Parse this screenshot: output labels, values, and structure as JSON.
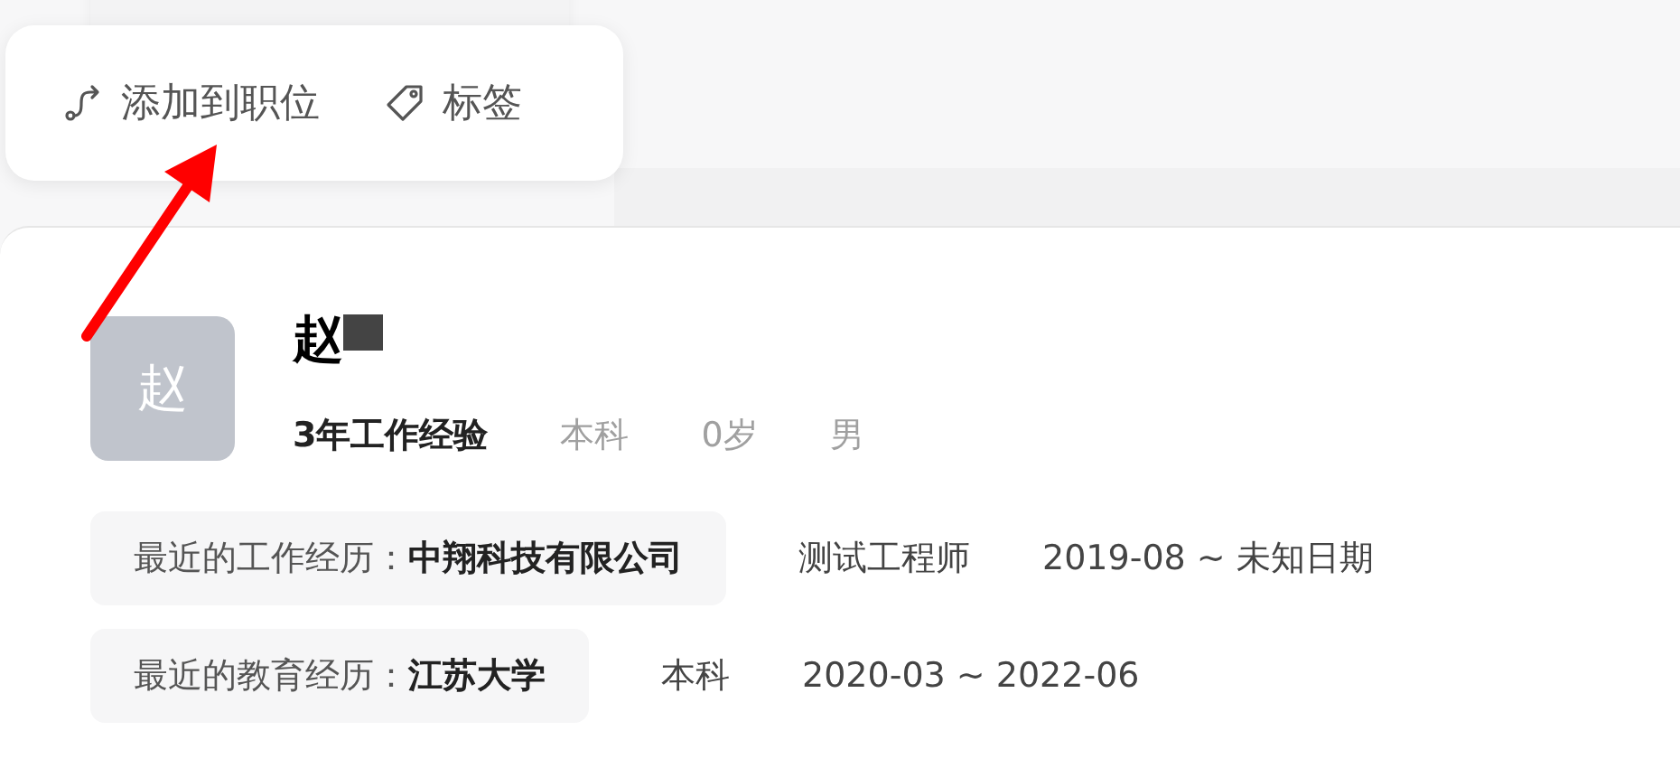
{
  "popover": {
    "actions": [
      {
        "kind": "route",
        "label": "添加到职位"
      },
      {
        "kind": "tag",
        "label": "标签"
      }
    ]
  },
  "candidate": {
    "avatar": "赵",
    "name": "赵",
    "name_redacted": true,
    "experience": "3年工作经验",
    "meta": [
      "本科",
      "0岁",
      "男"
    ],
    "history": [
      {
        "label": "最近的工作经历：",
        "value": "中翔科技有限公司",
        "details": [
          "测试工程师",
          "2019-08 ~ 未知日期"
        ]
      },
      {
        "label": "最近的教育经历：",
        "value": "江苏大学",
        "details": [
          "本科",
          "2020-03 ~ 2022-06"
        ]
      }
    ]
  }
}
